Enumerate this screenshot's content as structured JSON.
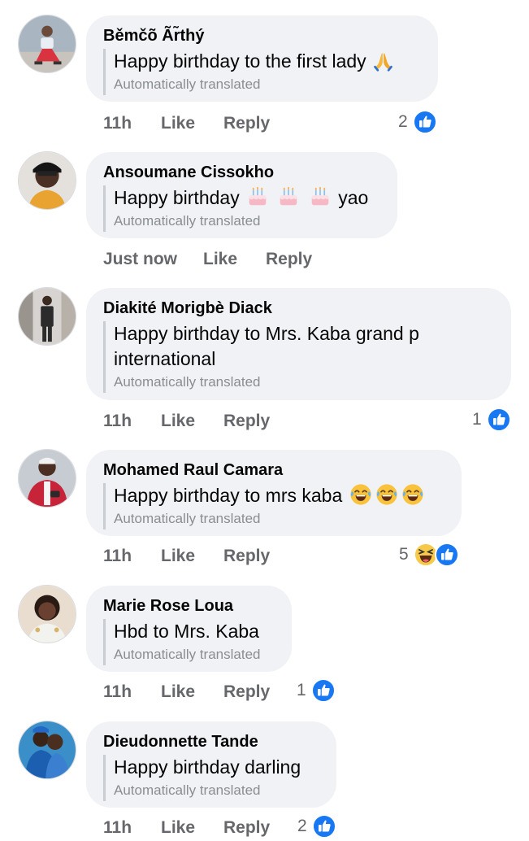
{
  "comments": [
    {
      "name": "Běmčõ Ãr̃thý",
      "text": "Happy birthday to the first lady",
      "emoji": [
        "pray"
      ],
      "translated": "Automatically translated",
      "time": "11h",
      "like": "Like",
      "reply": "Reply",
      "reaction_count": "2",
      "reactions": [
        "like"
      ]
    },
    {
      "name": "Ansoumane Cissokho",
      "text": "Happy birthday",
      "emoji": [
        "cake",
        "cake",
        "cake"
      ],
      "text_after": "yao",
      "translated": "Automatically translated",
      "time": "Just now",
      "like": "Like",
      "reply": "Reply"
    },
    {
      "name": "Diakité Morigbè Diack",
      "text_line1": "Happy birthday to Mrs. Kaba grand p",
      "text_line2": "international",
      "translated": "Automatically translated",
      "time": "11h",
      "like": "Like",
      "reply": "Reply",
      "reaction_count": "1",
      "reactions": [
        "like"
      ]
    },
    {
      "name": "Mohamed Raul Camara",
      "text": "Happy birthday to mrs kaba",
      "emoji": [
        "joy",
        "joy",
        "joy"
      ],
      "translated": "Automatically translated",
      "time": "11h",
      "like": "Like",
      "reply": "Reply",
      "reaction_count": "5",
      "reactions": [
        "haha",
        "like"
      ]
    },
    {
      "name": "Marie Rose Loua",
      "text": "Hbd to Mrs. Kaba",
      "translated": "Automatically translated",
      "time": "11h",
      "like": "Like",
      "reply": "Reply",
      "reaction_count": "1",
      "reactions": [
        "like"
      ]
    },
    {
      "name": "Dieudonnette Tande",
      "text": "Happy birthday darling",
      "translated": "Automatically translated",
      "time": "11h",
      "like": "Like",
      "reply": "Reply",
      "reaction_count": "2",
      "reactions": [
        "like"
      ]
    }
  ],
  "colors": {
    "bubble": "#f0f2f5",
    "like_blue": "#1877f2",
    "meta_gray": "#65676b",
    "translated_gray": "#8a8d91"
  }
}
